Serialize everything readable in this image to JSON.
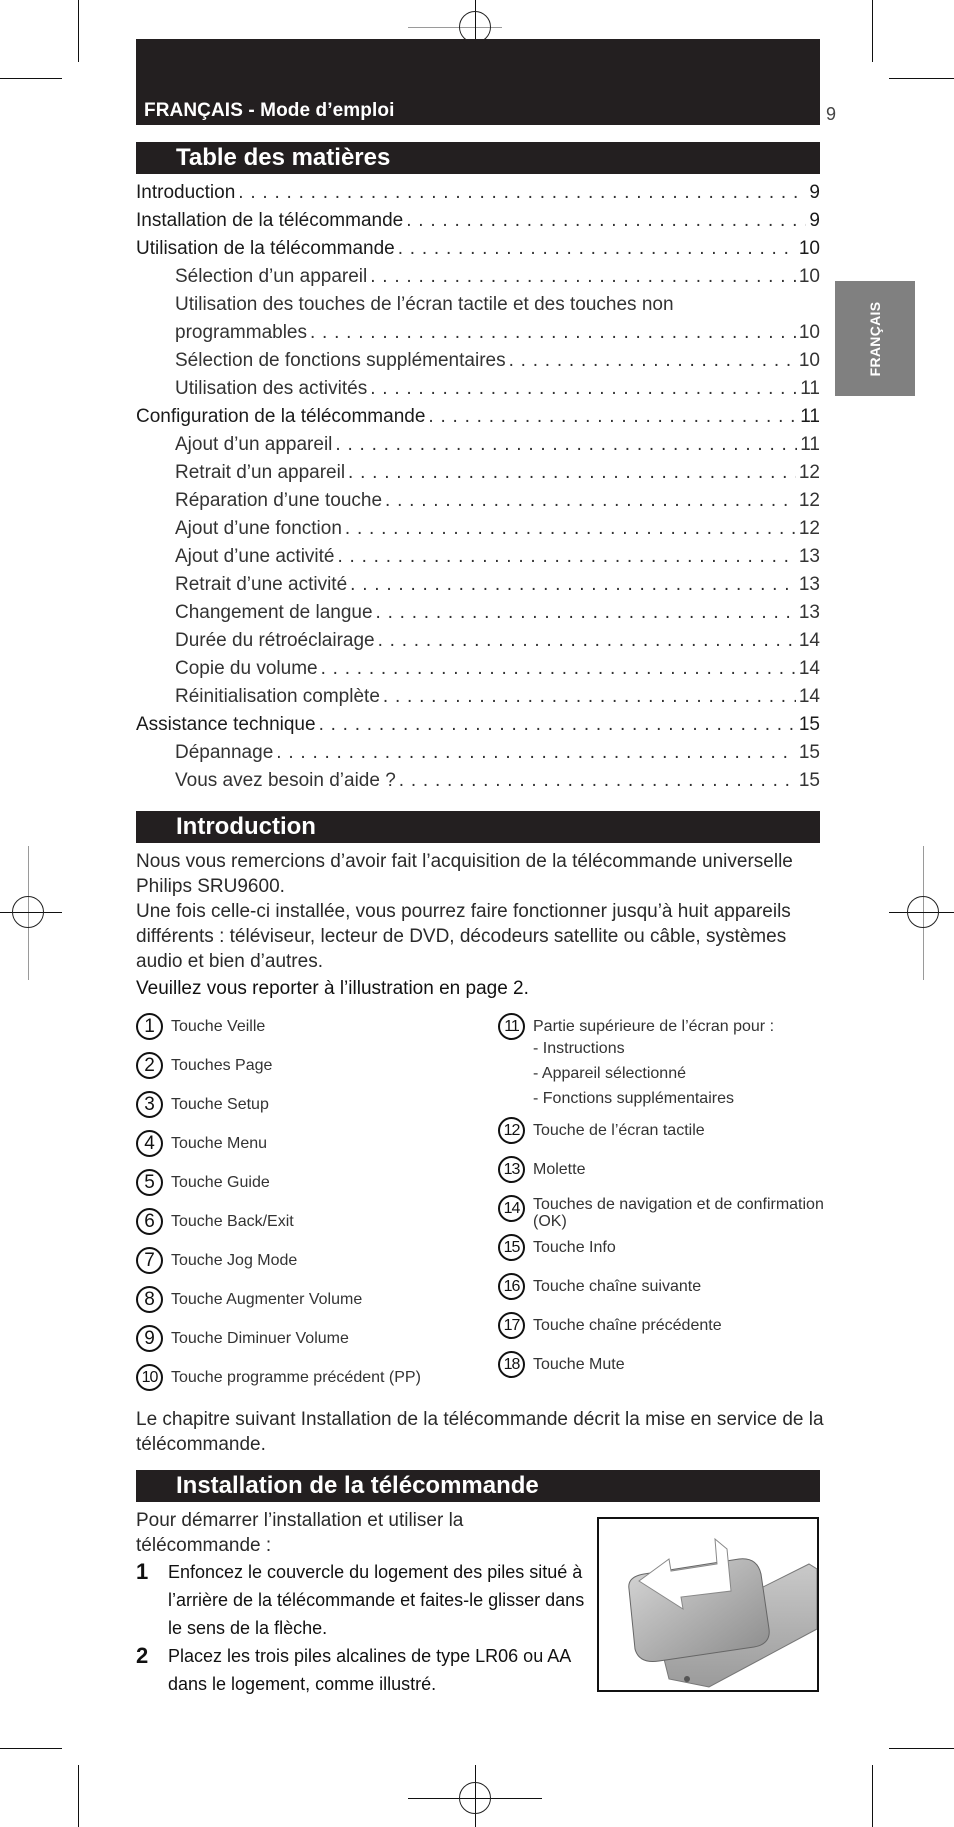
{
  "header": {
    "title": "FRANÇAIS - Mode d’emploi",
    "page_number": "9",
    "side_tab": "FRANÇAIS"
  },
  "toc": {
    "heading": "Table des matières",
    "entries": [
      {
        "level": 1,
        "title": "Introduction",
        "page": "9"
      },
      {
        "level": 1,
        "title": "Installation de la télécommande",
        "page": "9"
      },
      {
        "level": 1,
        "title": "Utilisation de la télécommande",
        "page": "10"
      },
      {
        "level": 2,
        "title": "Sélection d’un appareil",
        "page": "10"
      },
      {
        "level": 2,
        "title": "Utilisation des touches de l’écran tactile et des touches non",
        "page": ""
      },
      {
        "level": 2,
        "title": "programmables",
        "page": "10"
      },
      {
        "level": 2,
        "title": "Sélection de fonctions supplémentaires",
        "page": "10"
      },
      {
        "level": 2,
        "title": "Utilisation des activités",
        "page": "11"
      },
      {
        "level": 1,
        "title": "Configuration de la télécommande",
        "page": "11"
      },
      {
        "level": 2,
        "title": "Ajout d’un appareil",
        "page": "11"
      },
      {
        "level": 2,
        "title": "Retrait d’un appareil",
        "page": "12"
      },
      {
        "level": 2,
        "title": "Réparation d’une touche",
        "page": "12"
      },
      {
        "level": 2,
        "title": "Ajout d’une fonction",
        "page": "12"
      },
      {
        "level": 2,
        "title": "Ajout d’une activité",
        "page": "13"
      },
      {
        "level": 2,
        "title": "Retrait d’une activité",
        "page": "13"
      },
      {
        "level": 2,
        "title": "Changement de langue",
        "page": "13"
      },
      {
        "level": 2,
        "title": "Durée du rétroéclairage",
        "page": "14"
      },
      {
        "level": 2,
        "title": "Copie du volume",
        "page": "14"
      },
      {
        "level": 2,
        "title": "Réinitialisation complète",
        "page": "14"
      },
      {
        "level": 1,
        "title": "Assistance technique",
        "page": "15"
      },
      {
        "level": 2,
        "title": "Dépannage",
        "page": "15"
      },
      {
        "level": 2,
        "title": "Vous avez besoin d’aide ?",
        "page": "15"
      }
    ]
  },
  "introduction": {
    "heading": "Introduction",
    "paragraph1": "Nous vous remercions d’avoir fait l’acquisition de la télécommande universelle Philips SRU9600.",
    "paragraph2": "Une fois celle-ci installée, vous pourrez faire fonctionner jusqu’à huit appareils différents : téléviseur, lecteur de DVD, décodeurs satellite ou câble, systèmes audio et bien d’autres.",
    "note": "Veuillez vous reporter à l’illustration en page 2.",
    "legend_left": [
      {
        "num": "1",
        "label": "Touche Veille"
      },
      {
        "num": "2",
        "label": "Touches Page"
      },
      {
        "num": "3",
        "label": "Touche Setup"
      },
      {
        "num": "4",
        "label": "Touche Menu"
      },
      {
        "num": "5",
        "label": "Touche Guide"
      },
      {
        "num": "6",
        "label": "Touche Back/Exit"
      },
      {
        "num": "7",
        "label": "Touche Jog Mode"
      },
      {
        "num": "8",
        "label": "Touche Augmenter Volume"
      },
      {
        "num": "9",
        "label": "Touche Diminuer Volume"
      },
      {
        "num": "10",
        "label": "Touche programme précédent (PP)"
      }
    ],
    "legend_right": [
      {
        "num": "11",
        "label": "Partie supérieure de l’écran pour :",
        "sub": [
          "- Instructions",
          "- Appareil sélectionné",
          "- Fonctions supplémentaires"
        ]
      },
      {
        "num": "12",
        "label": "Touche de l’écran tactile"
      },
      {
        "num": "13",
        "label": "Molette"
      },
      {
        "num": "14",
        "label": "Touches de navigation et de confirmation (OK)"
      },
      {
        "num": "15",
        "label": "Touche Info"
      },
      {
        "num": "16",
        "label": "Touche chaîne suivante"
      },
      {
        "num": "17",
        "label": "Touche chaîne précédente"
      },
      {
        "num": "18",
        "label": "Touche Mute"
      }
    ],
    "closing": "Le chapitre suivant Installation de la télécommande décrit la mise en service de la télécommande."
  },
  "installation": {
    "heading": "Installation de la télécommande",
    "intro": "Pour démarrer l’installation et utiliser la télécommande :",
    "steps": [
      {
        "num": "1",
        "text": "Enfoncez le couvercle du logement des piles situé à l’arrière de la télécommande et faites-le glisser dans le sens de la flèche."
      },
      {
        "num": "2",
        "text": "Placez les trois piles alcalines de type LR06 ou AA dans le logement, comme illustré."
      }
    ],
    "figure_alt": "battery-cover-removal-illustration"
  }
}
